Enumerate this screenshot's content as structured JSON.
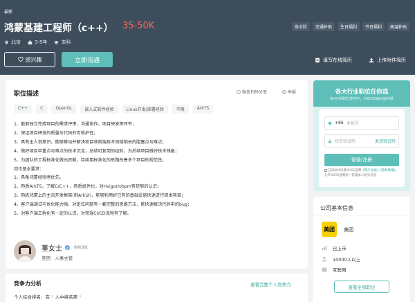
{
  "header": {
    "latest": "最新",
    "job_title": "鸿蒙基建工程师（c++）",
    "salary": "35-50K",
    "meta": {
      "city": "北京",
      "experience": "3-5年",
      "education": "本科"
    },
    "tags": [
      "商业险",
      "交通补助",
      "生日福利",
      "节日福利",
      "高温补贴"
    ],
    "btn_like": "感兴趣",
    "btn_chat": "立即沟通",
    "action_resume": "填写在线简历",
    "action_upload": "上传附件简历"
  },
  "description": {
    "title": "职位描述",
    "wechat_share": "微信扫码分享",
    "report": "举报",
    "skills": [
      "C++",
      "C",
      "OpenGL",
      "嵌入式软件经验",
      "Linux开发/部署经验",
      "不限",
      "ArkTS"
    ],
    "lines": [
      "1、能够独立完成项目的需求评审、沟通协作、项目研发等环节；",
      "2、保证项目研发的质量与代码的可维护性；",
      "3、具有主人翁意识，能够推动并解决项目非前端技术领域相关的阻塞点与难点；",
      "4、做好项目中重点与难点的技术沉淀，总结可复用的经验，为后续项目做好技术储备；",
      "5、为团队的工程标准化做出贡献，持续用标准化的思路改善多个项目的规范性。",
      "岗位基本要求：",
      "1、具备鸿蒙经验者优先。",
      "2、熟悉ArkTS，了解C/C++，熟悉组件化，对Hvigor/ohpm有足够的认识；",
      "3、熟练鸿蒙上的主流开发框架(例ArkUI)，能够利用好已有的基础设施快速进行研发项目；",
      "4、客户端调试与优化能力强，对定位问题有一套完整的思路方法，能快速解决代码中的bug；",
      "5、对客户端工程化有一定的认识，对常规CI/CD流程有了解。"
    ],
    "contact": {
      "name": "董女士",
      "status": "刚刚活跃",
      "role": "美团 · 人事主管"
    }
  },
  "competitiveness": {
    "title": "竞争力分析",
    "link": "查看完整个人竞争力",
    "rank_prefix": "个人综合排名：在",
    "rank_hidden": "?",
    "rank_suffix": "人中排名第",
    "rank_hidden2": "?"
  },
  "login": {
    "title": "各大行业职位任你选",
    "subtitle": "有4万新职位发布中，与BOSS面对面沟通",
    "country_code": "+86",
    "phone_placeholder": "手机号",
    "code_placeholder": "短信验证码",
    "send_code": "发送验证码",
    "submit": "登录/注册",
    "agree_prefix": "已阅读并同意BOSS直聘",
    "agree_link1": "《用户协议》",
    "agree_link2": "《隐私政策》",
    "agree_suffix": "，允许BOSS直聘统一管理本人账号信息"
  },
  "company": {
    "title": "公司基本信息",
    "logo_text": "美团",
    "name": "美团",
    "stage": "已上市",
    "size": "10000人以上",
    "industry": "互联网",
    "btn_all": "查看全部职位"
  }
}
